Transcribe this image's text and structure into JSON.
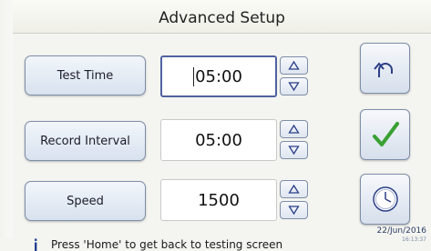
{
  "header": {
    "title": "Advanced Setup"
  },
  "fields": [
    {
      "label": "Test Time",
      "value": "05:00"
    },
    {
      "label": "Record Interval",
      "value": "05:00"
    },
    {
      "label": "Speed",
      "value": "1500"
    }
  ],
  "spinner": {
    "up_icon": "triangle-up-icon",
    "down_icon": "triangle-down-icon"
  },
  "side_buttons": {
    "back_icon": "undo-arrow-icon",
    "confirm_icon": "checkmark-icon",
    "clock_icon": "clock-icon"
  },
  "status": {
    "message": "Press 'Home' to get back to testing screen",
    "date": "22/Jun/2016",
    "time": "16:13:37"
  },
  "colors": {
    "accent": "#5062a2",
    "confirm": "#3aa033",
    "button_border": "#7d8ea8"
  }
}
